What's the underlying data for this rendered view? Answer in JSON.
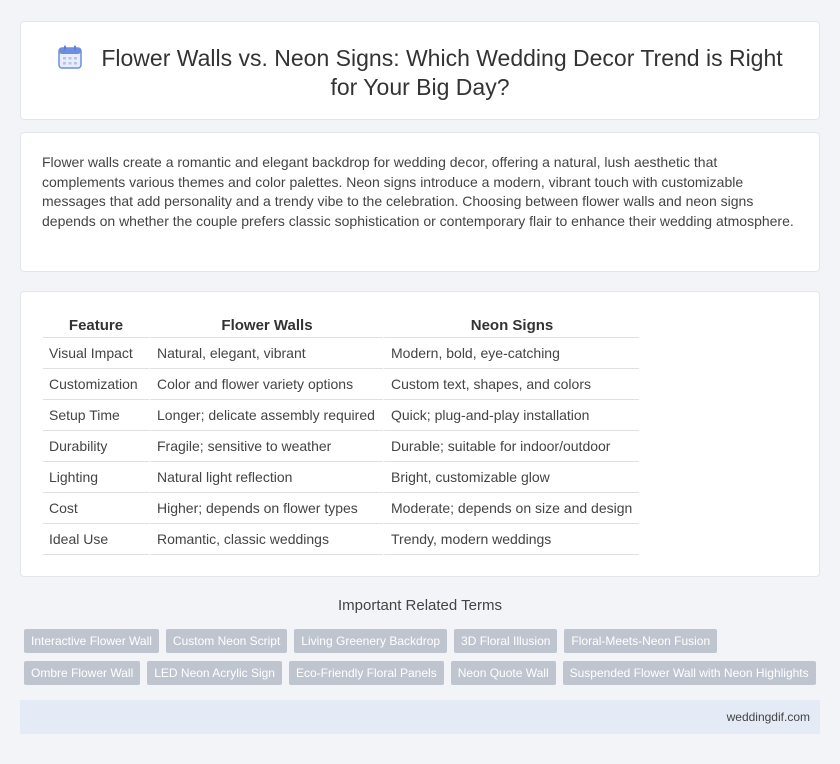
{
  "header": {
    "title_line1": "Flower Walls vs. Neon Signs: Which Wedding Decor Trend is Right",
    "title_line2": "for Your Big Day?",
    "icon": "calendar-icon"
  },
  "intro": {
    "text": "Flower walls create a romantic and elegant backdrop for wedding decor, offering a natural, lush aesthetic that complements various themes and color palettes. Neon signs introduce a modern, vibrant touch with customizable messages that add personality and a trendy vibe to the celebration. Choosing between flower walls and neon signs depends on whether the couple prefers classic sophistication or contemporary flair to enhance their wedding atmosphere."
  },
  "table": {
    "headers": [
      "Feature",
      "Flower Walls",
      "Neon Signs"
    ],
    "rows": [
      [
        "Visual Impact",
        "Natural, elegant, vibrant",
        "Modern, bold, eye-catching"
      ],
      [
        "Customization",
        "Color and flower variety options",
        "Custom text, shapes, and colors"
      ],
      [
        "Setup Time",
        "Longer; delicate assembly required",
        "Quick; plug-and-play installation"
      ],
      [
        "Durability",
        "Fragile; sensitive to weather",
        "Durable; suitable for indoor/outdoor"
      ],
      [
        "Lighting",
        "Natural light reflection",
        "Bright, customizable glow"
      ],
      [
        "Cost",
        "Higher; depends on flower types",
        "Moderate; depends on size and design"
      ],
      [
        "Ideal Use",
        "Romantic, classic weddings",
        "Trendy, modern weddings"
      ]
    ]
  },
  "related": {
    "heading": "Important Related Terms",
    "row1": [
      "Interactive Flower Wall",
      "Custom Neon Script",
      "Living Greenery Backdrop",
      "3D Floral Illusion",
      "Floral-Meets-Neon Fusion"
    ],
    "row2": [
      "Ombre Flower Wall",
      "LED Neon Acrylic Sign",
      "Eco-Friendly Floral Panels",
      "Neon Quote Wall",
      "Suspended Flower Wall with Neon Highlights"
    ]
  },
  "footer": {
    "site": "weddingdif.com"
  },
  "colors": {
    "tag_bg": "#bfc5cf",
    "footer_bg": "#e4eaf6",
    "icon_accent": "#5b7fd6"
  }
}
